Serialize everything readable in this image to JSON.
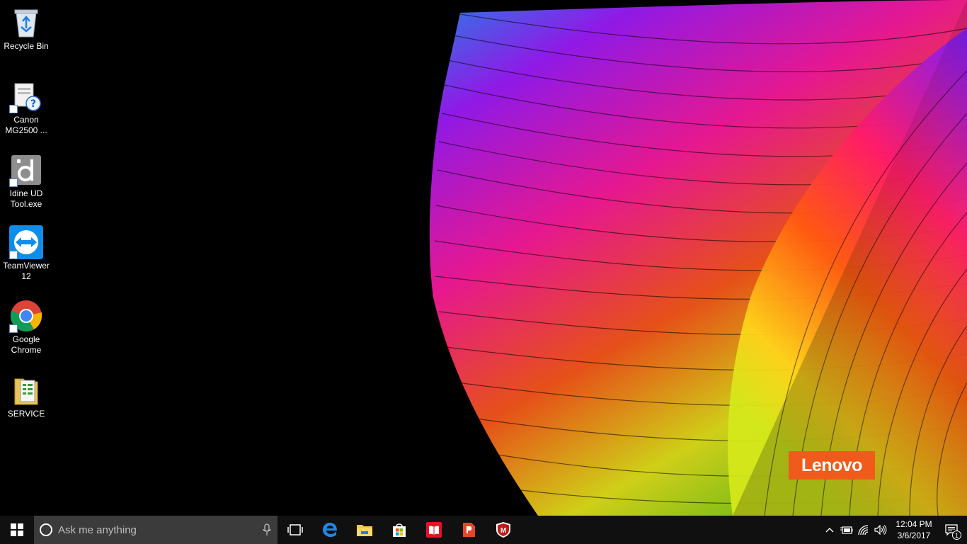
{
  "desktop": {
    "icons": [
      {
        "label": "Recycle Bin",
        "icon": "recycle-bin-icon"
      },
      {
        "label": "Canon\nMG2500 ...",
        "icon": "canon-printer-help-icon"
      },
      {
        "label": "Idine UD\nTool.exe",
        "icon": "idine-app-icon"
      },
      {
        "label": "TeamViewer\n12",
        "icon": "teamviewer-icon"
      },
      {
        "label": "Google\nChrome",
        "icon": "chrome-icon"
      },
      {
        "label": "SERVICE",
        "icon": "spreadsheet-folder-icon"
      }
    ],
    "wallpaper_brand": "Lenovo",
    "colors": {
      "brand": "#f05a1a"
    }
  },
  "taskbar": {
    "search_placeholder": "Ask me anything",
    "pinned": [
      {
        "name": "task-view-icon"
      },
      {
        "name": "edge-icon"
      },
      {
        "name": "file-explorer-icon"
      },
      {
        "name": "store-icon"
      },
      {
        "name": "reader-icon"
      },
      {
        "name": "docs-app-icon"
      },
      {
        "name": "mcafee-icon"
      }
    ],
    "tray": {
      "time": "12:04 PM",
      "date": "3/6/2017",
      "notification_count": "1"
    }
  }
}
